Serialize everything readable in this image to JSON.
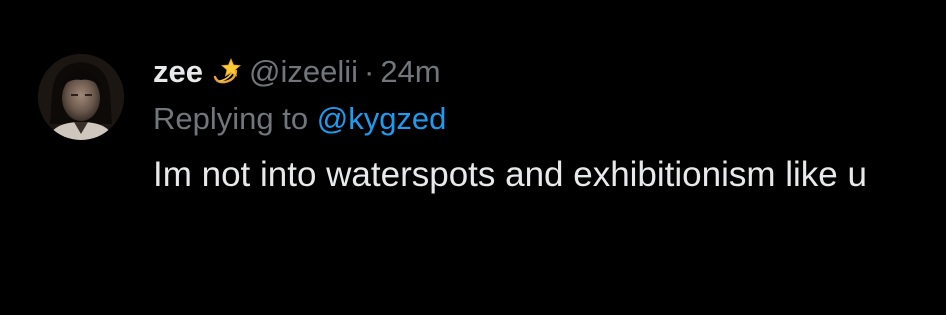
{
  "tweet": {
    "display_name": "zee",
    "badge_icon": "dizzy-star-icon",
    "handle": "@izeelii",
    "separator": "·",
    "time": "24m",
    "replying_prefix": "Replying to",
    "replying_to": "@kygzed",
    "text": "Im not into waterspots and exhibitionism like u"
  },
  "colors": {
    "background": "#000000",
    "primary_text": "#e7e9ea",
    "secondary_text": "#71767b",
    "link": "#1d9bf0"
  }
}
